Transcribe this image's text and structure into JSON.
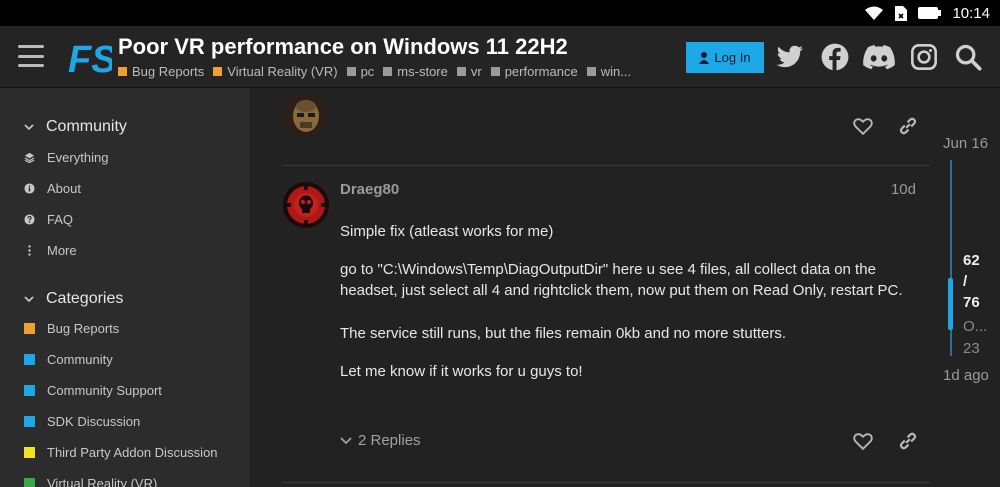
{
  "status_bar": {
    "time": "10:14",
    "icons": [
      "wifi-icon",
      "sim-icon",
      "battery-icon"
    ]
  },
  "header": {
    "logo_text": "FS",
    "title": "Poor VR performance on Windows 11 22H2",
    "tags": [
      {
        "label": "Bug Reports",
        "color": "#f0a030"
      },
      {
        "label": "Virtual Reality (VR)",
        "color": "#f0a030"
      },
      {
        "label": "pc",
        "color": "#9a9a9a"
      },
      {
        "label": "ms-store",
        "color": "#9a9a9a"
      },
      {
        "label": "vr",
        "color": "#9a9a9a"
      },
      {
        "label": "performance",
        "color": "#9a9a9a"
      },
      {
        "label": "win...",
        "color": "#9a9a9a"
      }
    ],
    "login_label": "Log In",
    "icons": [
      "twitter-icon",
      "facebook-icon",
      "discord-icon",
      "instagram-icon",
      "search-icon"
    ]
  },
  "sidebar": {
    "community": {
      "heading": "Community",
      "items": [
        {
          "label": "Everything",
          "icon": "layers-icon"
        },
        {
          "label": "About",
          "icon": "info-icon"
        },
        {
          "label": "FAQ",
          "icon": "question-icon"
        },
        {
          "label": "More",
          "icon": "more-vertical-icon"
        }
      ]
    },
    "categories": {
      "heading": "Categories",
      "items": [
        {
          "label": "Bug Reports",
          "color": "#f0a030"
        },
        {
          "label": "Community",
          "color": "#1ea7e6"
        },
        {
          "label": "Community Support",
          "color": "#1ea7e6"
        },
        {
          "label": "SDK Discussion",
          "color": "#1ea7e6"
        },
        {
          "label": "Third Party Addon Discussion",
          "color": "#f5e020"
        },
        {
          "label": "Virtual Reality (VR)",
          "color": "#3aa84a"
        }
      ]
    }
  },
  "post": {
    "username": "Draeg80",
    "date": "10d",
    "paragraphs": [
      "Simple fix (atleast works for me)",
      "go to \"C:\\Windows\\Temp\\DiagOutputDir\" here u see 4 files, all collect data on the headset, just select all 4 and rightclick them, now put them on Read Only, restart PC.",
      "The service still runs, but the files remain 0kb and no more stutters.",
      "Let me know if it works for u guys to!"
    ],
    "replies_label": "2 Replies"
  },
  "timeline": {
    "top_date": "Jun 16",
    "position": "62",
    "slash": "/",
    "total": "76",
    "sub_label": "O...",
    "sub_date": "23",
    "bottom_date": "1d ago"
  },
  "colors": {
    "accent": "#1ea7e6",
    "background": "#222222",
    "sidebar": "#2c2c2c"
  }
}
